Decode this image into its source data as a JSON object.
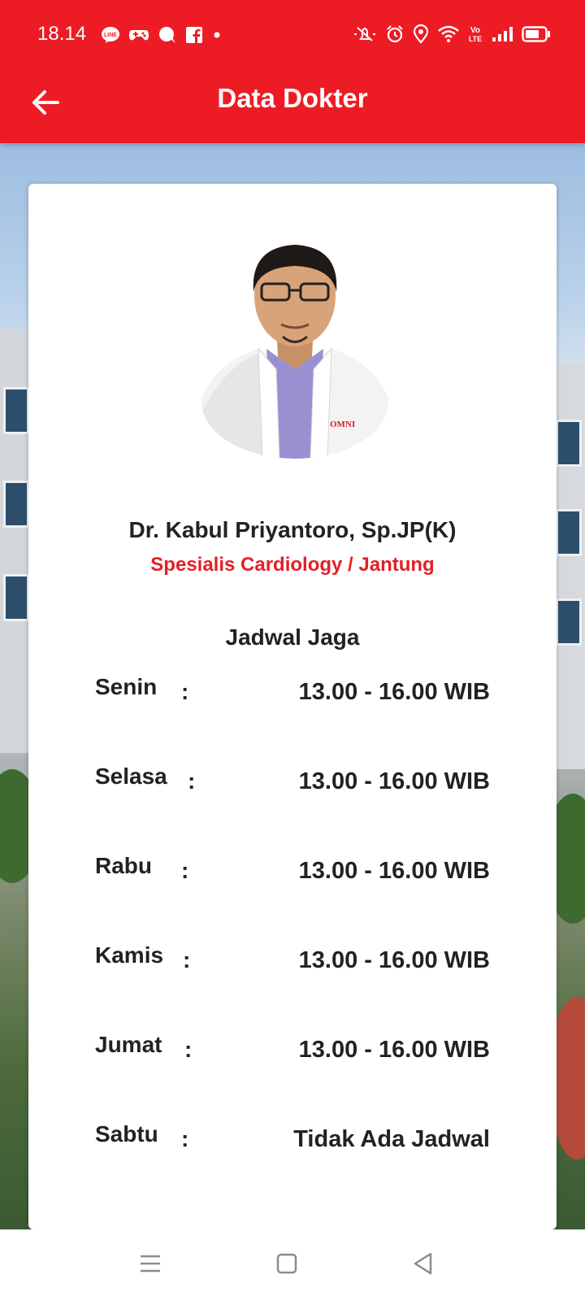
{
  "status_bar": {
    "time": "18.14",
    "left_icons": [
      "line-icon",
      "game-controller-icon",
      "chat-bubble-icon",
      "facebook-icon",
      "dot-icon"
    ],
    "right_icons": [
      "mute-icon",
      "alarm-icon",
      "location-icon",
      "wifi-icon",
      "volte-icon",
      "signal-icon",
      "battery-icon"
    ]
  },
  "app_bar": {
    "title": "Data Dokter",
    "back_icon": "arrow-left-icon"
  },
  "colors": {
    "brand_red": "#ed1c24",
    "specialty_red": "#e41f26",
    "text_dark": "#222222"
  },
  "doctor": {
    "name": "Dr. Kabul Priyantoro, Sp.JP(K)",
    "specialty": "Spesialis Cardiology / Jantung",
    "coat_logo": "OMNI"
  },
  "schedule": {
    "title": "Jadwal Jaga",
    "separator": ":",
    "rows": [
      {
        "day": "Senin",
        "hours": "13.00 - 16.00 WIB"
      },
      {
        "day": "Selasa",
        "hours": "13.00 - 16.00 WIB"
      },
      {
        "day": "Rabu",
        "hours": "13.00 - 16.00 WIB"
      },
      {
        "day": "Kamis",
        "hours": "13.00 - 16.00 WIB"
      },
      {
        "day": "Jumat",
        "hours": "13.00 - 16.00 WIB"
      },
      {
        "day": "Sabtu",
        "hours": "Tidak Ada Jadwal"
      }
    ]
  },
  "nav_bar": {
    "buttons": [
      "menu-icon",
      "home-square-icon",
      "back-triangle-icon"
    ]
  }
}
